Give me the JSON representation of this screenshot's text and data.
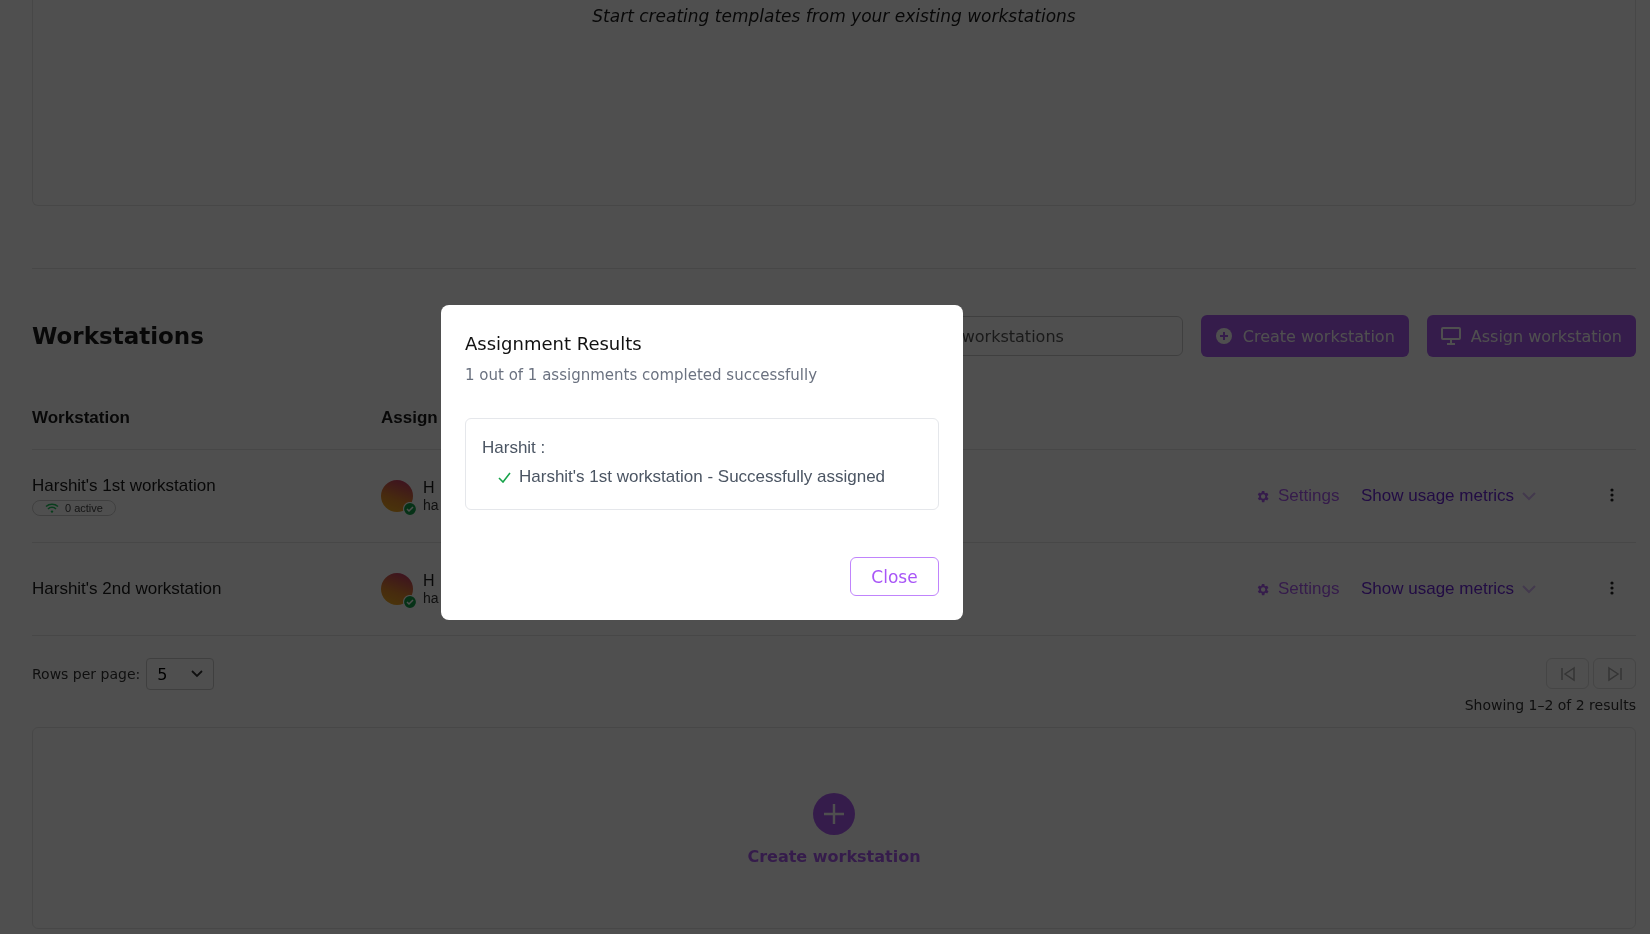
{
  "empty_state": {
    "message": "Start creating templates from your existing workstations"
  },
  "workstations": {
    "title": "Workstations",
    "search": {
      "placeholder": "workstations"
    },
    "buttons": [
      {
        "label": "Create workstation",
        "kind": "create"
      },
      {
        "label": "Assign workstation",
        "kind": "assign"
      }
    ],
    "table": {
      "columns": [
        "Workstation",
        "Assign"
      ],
      "rows": [
        {
          "name": "Harshit's 1st workstation",
          "badge": "0 active",
          "assignee_name": "H",
          "assignee_email": "ha",
          "verified": true,
          "settings": "Settings",
          "metrics": "Show usage metrics"
        },
        {
          "name": "Harshit's 2nd workstation",
          "assignee_name": "H",
          "assignee_email": "ha",
          "verified": true,
          "settings": "Settings",
          "metrics": "Show usage metrics"
        }
      ]
    },
    "pagination": {
      "rows_per_page_label": "Rows per page:",
      "rows_per_page": "5",
      "summary": "Showing 1–2 of 2 results"
    }
  },
  "create_card": {
    "label": "Create workstation"
  },
  "modal": {
    "title": "Assignment Results",
    "subtitle": "1 out of 1 assignments completed successfully",
    "results": [
      {
        "user": "Harshit :",
        "items": [
          {
            "text": "Harshit's 1st workstation - Successfully assigned",
            "success": true
          }
        ]
      }
    ],
    "close": "Close"
  }
}
